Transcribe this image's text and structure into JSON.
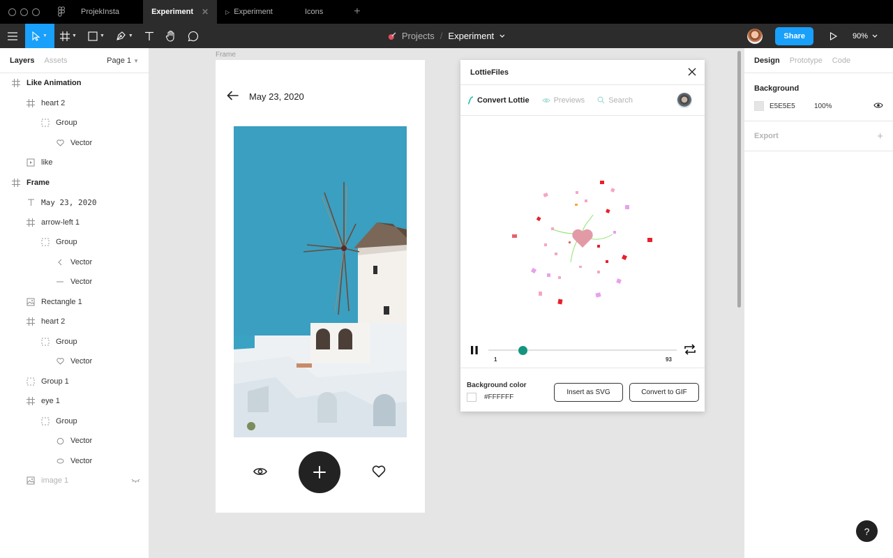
{
  "tabbar": {
    "tabs": [
      {
        "label": "ProjekInsta"
      },
      {
        "label": "Experiment",
        "active": true
      },
      {
        "label": "Experiment",
        "prototype": true
      },
      {
        "label": "Icons"
      }
    ],
    "add_tab": "+"
  },
  "toolbar": {
    "breadcrumb_project": "Projects",
    "breadcrumb_sep": "/",
    "breadcrumb_file": "Experiment",
    "share_label": "Share",
    "zoom": "90%"
  },
  "left_panel": {
    "tab_layers": "Layers",
    "tab_assets": "Assets",
    "page": "Page 1",
    "layers": [
      {
        "label": "Like Animation",
        "icon": "frame-icon",
        "depth": 0,
        "bold": true
      },
      {
        "label": "heart 2",
        "icon": "frame-icon",
        "depth": 1
      },
      {
        "label": "Group",
        "icon": "group-icon",
        "depth": 2
      },
      {
        "label": "Vector",
        "icon": "heart-icon",
        "depth": 3
      },
      {
        "label": "like",
        "icon": "component-icon",
        "depth": 1
      },
      {
        "label": "Frame",
        "icon": "frame-icon",
        "depth": 0,
        "bold": true
      },
      {
        "label": "May 23, 2020",
        "icon": "text-icon",
        "depth": 1
      },
      {
        "label": "arrow-left 1",
        "icon": "frame-icon",
        "depth": 1
      },
      {
        "label": "Group",
        "icon": "group-icon",
        "depth": 2
      },
      {
        "label": "Vector",
        "icon": "chevron-left-icon",
        "depth": 3
      },
      {
        "label": "Vector",
        "icon": "line-icon",
        "depth": 3
      },
      {
        "label": "Rectangle 1",
        "icon": "image-icon",
        "depth": 1
      },
      {
        "label": "heart 2",
        "icon": "frame-icon",
        "depth": 1
      },
      {
        "label": "Group",
        "icon": "group-icon",
        "depth": 2
      },
      {
        "label": "Vector",
        "icon": "heart-icon",
        "depth": 3
      },
      {
        "label": "Group 1",
        "icon": "group-icon",
        "depth": 1
      },
      {
        "label": "eye 1",
        "icon": "frame-icon",
        "depth": 1
      },
      {
        "label": "Group",
        "icon": "group-icon",
        "depth": 2
      },
      {
        "label": "Vector",
        "icon": "circle-icon",
        "depth": 3
      },
      {
        "label": "Vector",
        "icon": "ellipse-icon",
        "depth": 3
      },
      {
        "label": "image 1",
        "icon": "image-icon",
        "depth": 1,
        "dim": true,
        "hidden": true
      }
    ]
  },
  "canvas": {
    "frame_label": "Frame",
    "frame_date": "May 23, 2020"
  },
  "plugin": {
    "title": "LottieFiles",
    "nav_convert": "Convert Lottie",
    "nav_previews": "Previews",
    "nav_search": "Search",
    "frame_start": "1",
    "frame_end": "93",
    "progress": 0.18,
    "bg_label": "Background color",
    "bg_hex": "#FFFFFF",
    "btn_svg": "Insert as SVG",
    "btn_gif": "Convert to GIF"
  },
  "right_panel": {
    "tab_design": "Design",
    "tab_prototype": "Prototype",
    "tab_code": "Code",
    "background_title": "Background",
    "bg_hex": "E5E5E5",
    "bg_opacity": "100%",
    "export_title": "Export",
    "export_add": "+"
  },
  "help": "?"
}
